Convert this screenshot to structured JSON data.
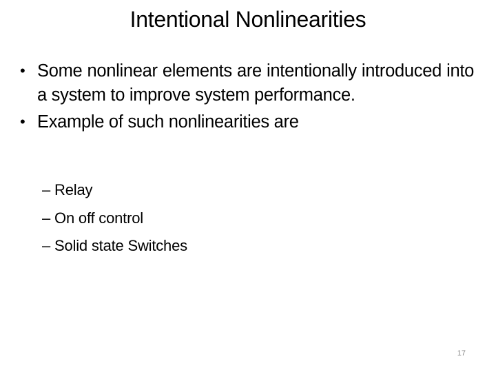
{
  "slide": {
    "title": "Intentional Nonlinearities",
    "bullets": [
      {
        "marker": "•",
        "text": "Some nonlinear elements are intentionally introduced into a system to improve system performance."
      },
      {
        "marker": "•",
        "text": "Example of such nonlinearities are"
      }
    ],
    "sub_bullets": [
      {
        "marker": "–",
        "text": "Relay"
      },
      {
        "marker": "–",
        "text": "On off control"
      },
      {
        "marker": "–",
        "text": "Solid state Switches"
      }
    ],
    "page_number": "17"
  }
}
